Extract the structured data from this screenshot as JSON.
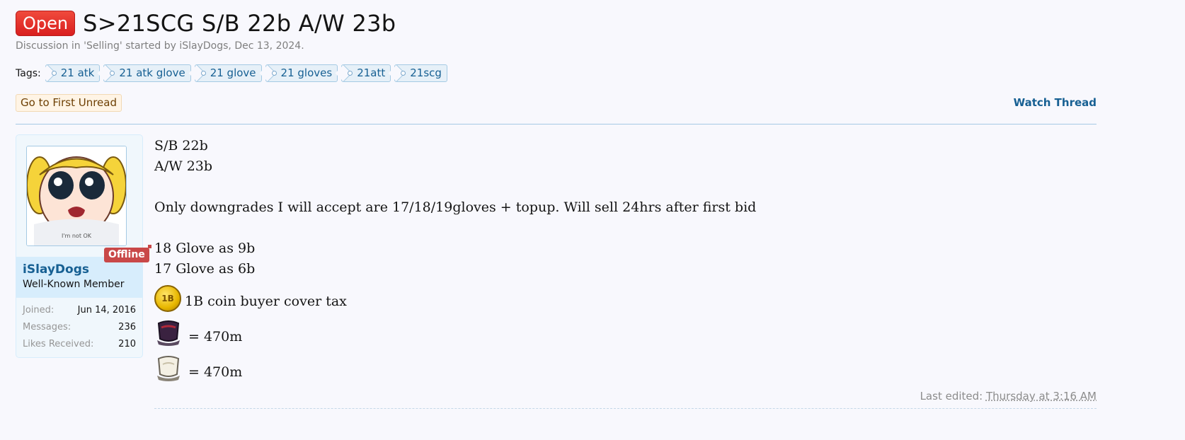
{
  "thread": {
    "prefix": "Open",
    "title": "S>21SCG S/B 22b A/W 23b",
    "meta": "Discussion in 'Selling' started by iSlayDogs, Dec 13, 2024."
  },
  "tags": {
    "label": "Tags:",
    "items": [
      "21 atk",
      "21 atk glove",
      "21 glove",
      "21 gloves",
      "21att",
      "21scg"
    ]
  },
  "actions": {
    "first_unread": "Go to First Unread",
    "watch_thread": "Watch Thread"
  },
  "user": {
    "status": "Offline",
    "name": "iSlayDogs",
    "title": "Well-Known Member",
    "avatar_caption": "I'm not OK",
    "stats": [
      {
        "label": "Joined:",
        "value": "Jun 14, 2016"
      },
      {
        "label": "Messages:",
        "value": "236"
      },
      {
        "label": "Likes Received:",
        "value": "210"
      }
    ]
  },
  "post": {
    "line1": "S/B 22b",
    "line2": "A/W 23b",
    "line3": "Only downgrades I will accept are 17/18/19gloves + topup. Will sell 24hrs after first bid",
    "line4": "18 Glove as 9b",
    "line5": "17 Glove as 6b",
    "coin_label": "1B",
    "line6": "1B coin buyer cover tax",
    "line7": "= 470m",
    "line8": "= 470m",
    "last_edited_label": "Last edited:",
    "last_edited_time": "Thursday at 3:16 AM"
  },
  "colors": {
    "prefix_bg": "#e52626",
    "link": "#176093",
    "offline_bg": "#c94848",
    "panel_bg": "#f0f7fc"
  }
}
